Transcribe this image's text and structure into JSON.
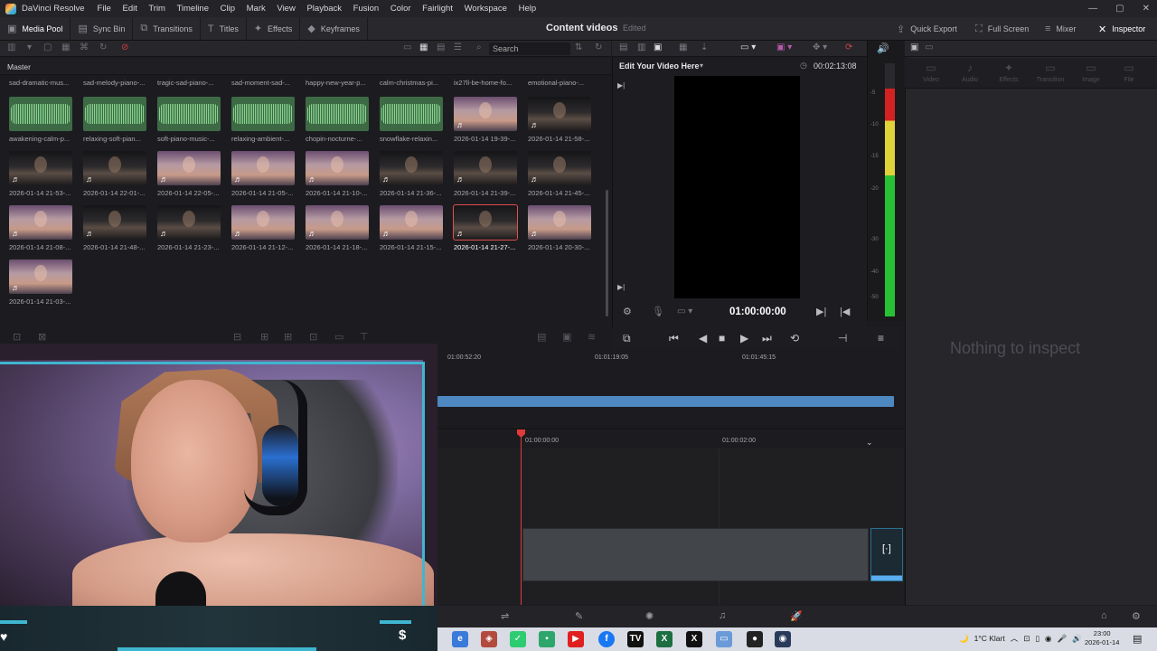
{
  "app": {
    "title": "DaVinci Resolve",
    "menu": [
      "File",
      "Edit",
      "Trim",
      "Timeline",
      "Clip",
      "Mark",
      "View",
      "Playback",
      "Fusion",
      "Color",
      "Fairlight",
      "Workspace",
      "Help"
    ]
  },
  "toolbar": {
    "left": [
      "Media Pool",
      "Sync Bin",
      "Transitions",
      "Titles",
      "Effects",
      "Keyframes"
    ],
    "project_title": "Content videos",
    "project_status": "Edited",
    "right": [
      "Quick Export",
      "Full Screen",
      "Mixer",
      "Inspector"
    ]
  },
  "media_pool": {
    "search_placeholder": "Search",
    "bin": "Master",
    "top_row_labels": [
      "sad-dramatic-mus...",
      "sad-melody-piano-...",
      "tragic-sad-piano-...",
      "sad-moment-sad-...",
      "happy-new-year-p...",
      "calm-christmas-pi...",
      "ix27ll-be-home-fo...",
      "emotional-piano-..."
    ],
    "clips": [
      {
        "label": "awakening-calm-p...",
        "kind": "wave"
      },
      {
        "label": "relaxing-soft-pian...",
        "kind": "wave"
      },
      {
        "label": "soft-piano-music-...",
        "kind": "wave"
      },
      {
        "label": "relaxing-ambient-...",
        "kind": "wave"
      },
      {
        "label": "chopin-nocturne-...",
        "kind": "wave"
      },
      {
        "label": "snowflake-relaxin...",
        "kind": "wave"
      },
      {
        "label": "2026-01-14 19-39-...",
        "kind": "light"
      },
      {
        "label": "2026-01-14 21-58-...",
        "kind": "dark"
      },
      {
        "label": "2026-01-14 21-53-...",
        "kind": "dark"
      },
      {
        "label": "2026-01-14 22-01-...",
        "kind": "dark"
      },
      {
        "label": "2026-01-14 22-05-...",
        "kind": "light"
      },
      {
        "label": "2026-01-14 21-05-...",
        "kind": "light"
      },
      {
        "label": "2026-01-14 21-10-...",
        "kind": "light"
      },
      {
        "label": "2026-01-14 21-36-...",
        "kind": "dark"
      },
      {
        "label": "2026-01-14 21-39-...",
        "kind": "dark"
      },
      {
        "label": "2026-01-14 21-45-...",
        "kind": "dark"
      },
      {
        "label": "2026-01-14 21-08-...",
        "kind": "light"
      },
      {
        "label": "2026-01-14 21-48-...",
        "kind": "dark"
      },
      {
        "label": "2026-01-14 21-23-...",
        "kind": "dark"
      },
      {
        "label": "2026-01-14 21-12-...",
        "kind": "light"
      },
      {
        "label": "2026-01-14 21-18-...",
        "kind": "light"
      },
      {
        "label": "2026-01-14 21-15-...",
        "kind": "light"
      },
      {
        "label": "2026-01-14 21-27-...",
        "kind": "dark",
        "selected": true
      },
      {
        "label": "2026-01-14 20-30-...",
        "kind": "light"
      },
      {
        "label": "2026-01-14 21-03-...",
        "kind": "light"
      }
    ]
  },
  "viewer": {
    "title": "Edit Your Video Here",
    "duration": "00:02:13:08",
    "timecode": "01:00:00:00"
  },
  "meter": {
    "labels": [
      "-5",
      "-10",
      "-15",
      "-20",
      "-30",
      "-40",
      "-50"
    ],
    "level_fraction": 0.82
  },
  "inspector": {
    "tabs": [
      "Video",
      "Audio",
      "Effects",
      "Transition",
      "Image",
      "File"
    ],
    "empty_text": "Nothing to inspect"
  },
  "timeline": {
    "upper_ruler": [
      "01:00:52:20",
      "01:01:19:05",
      "01:01:45:15"
    ],
    "lower_ruler": [
      "01:00:00:00",
      "01:00:02:00"
    ]
  },
  "taskbar": {
    "weather": "1°C  Klart",
    "time": "23:00",
    "date": "2026-01-14"
  },
  "colors": {
    "accent_red": "#e03a3a",
    "overlay_cyan": "#3fb6d0",
    "timeline_blue": "#4e88c0"
  }
}
